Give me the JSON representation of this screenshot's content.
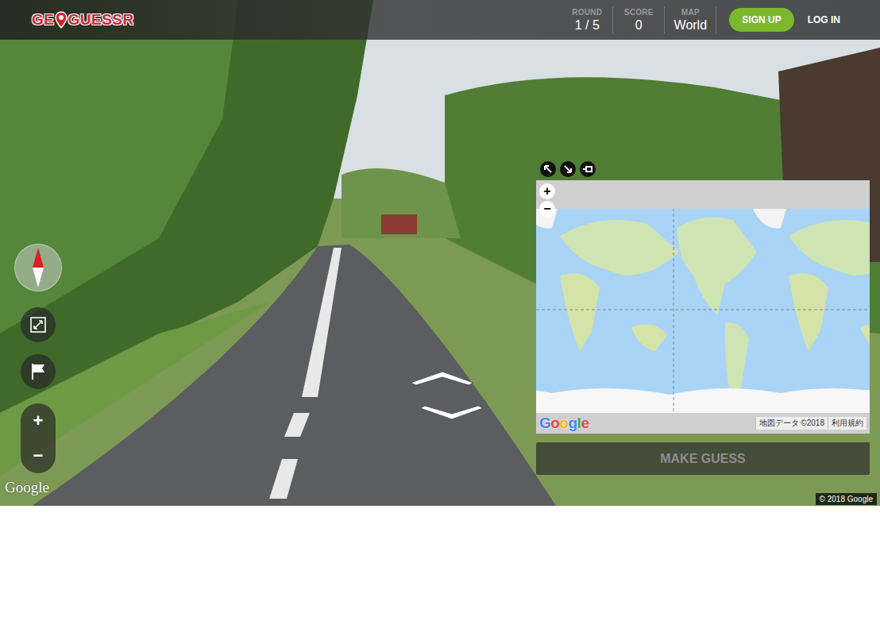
{
  "header": {
    "logo": {
      "left": "GE",
      "right": "GUESSR"
    },
    "stats": [
      {
        "label": "ROUND",
        "value": "1 / 5"
      },
      {
        "label": "SCORE",
        "value": "0"
      },
      {
        "label": "MAP",
        "value": "World"
      }
    ],
    "buttons": [
      {
        "label": "SIGN UP"
      },
      {
        "label": "LOG IN"
      }
    ]
  },
  "controls": {
    "zoom_in": "+",
    "zoom_out": "−"
  },
  "viewer": {
    "logo": "Google",
    "copyright": "© 2018 Google"
  },
  "map": {
    "zoom_in": "+",
    "zoom_out": "−",
    "logo": "Google",
    "attribution": "地図データ ©2018",
    "terms": "利用規約",
    "guess_button": {
      "label": "MAKE GUESS",
      "disabled": true
    }
  }
}
